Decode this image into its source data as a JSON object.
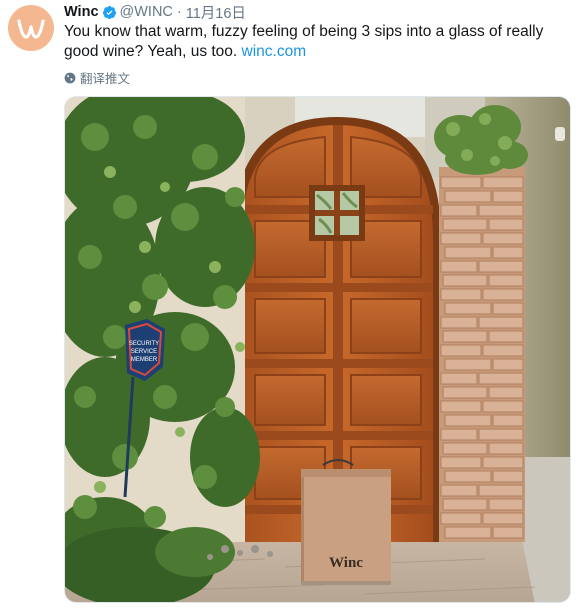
{
  "tweet": {
    "display_name": "Winc",
    "handle": "@WINC",
    "separator": "·",
    "timestamp": "11月16日",
    "text": "You know that warm, fuzzy feeling of being 3 sips into a glass of really good wine? Yeah, us too.",
    "link_text": "winc.com",
    "translate_label": "翻译推文"
  },
  "avatar": {
    "icon": "winc-logo-icon",
    "color": "#f4b78f"
  },
  "media": {
    "box_brand": "Winc",
    "plaque_text": "SECURITY SERVICE MEMBER"
  },
  "colors": {
    "link": "#1b95e0",
    "muted": "#657786",
    "verified": "#1da1f2"
  }
}
